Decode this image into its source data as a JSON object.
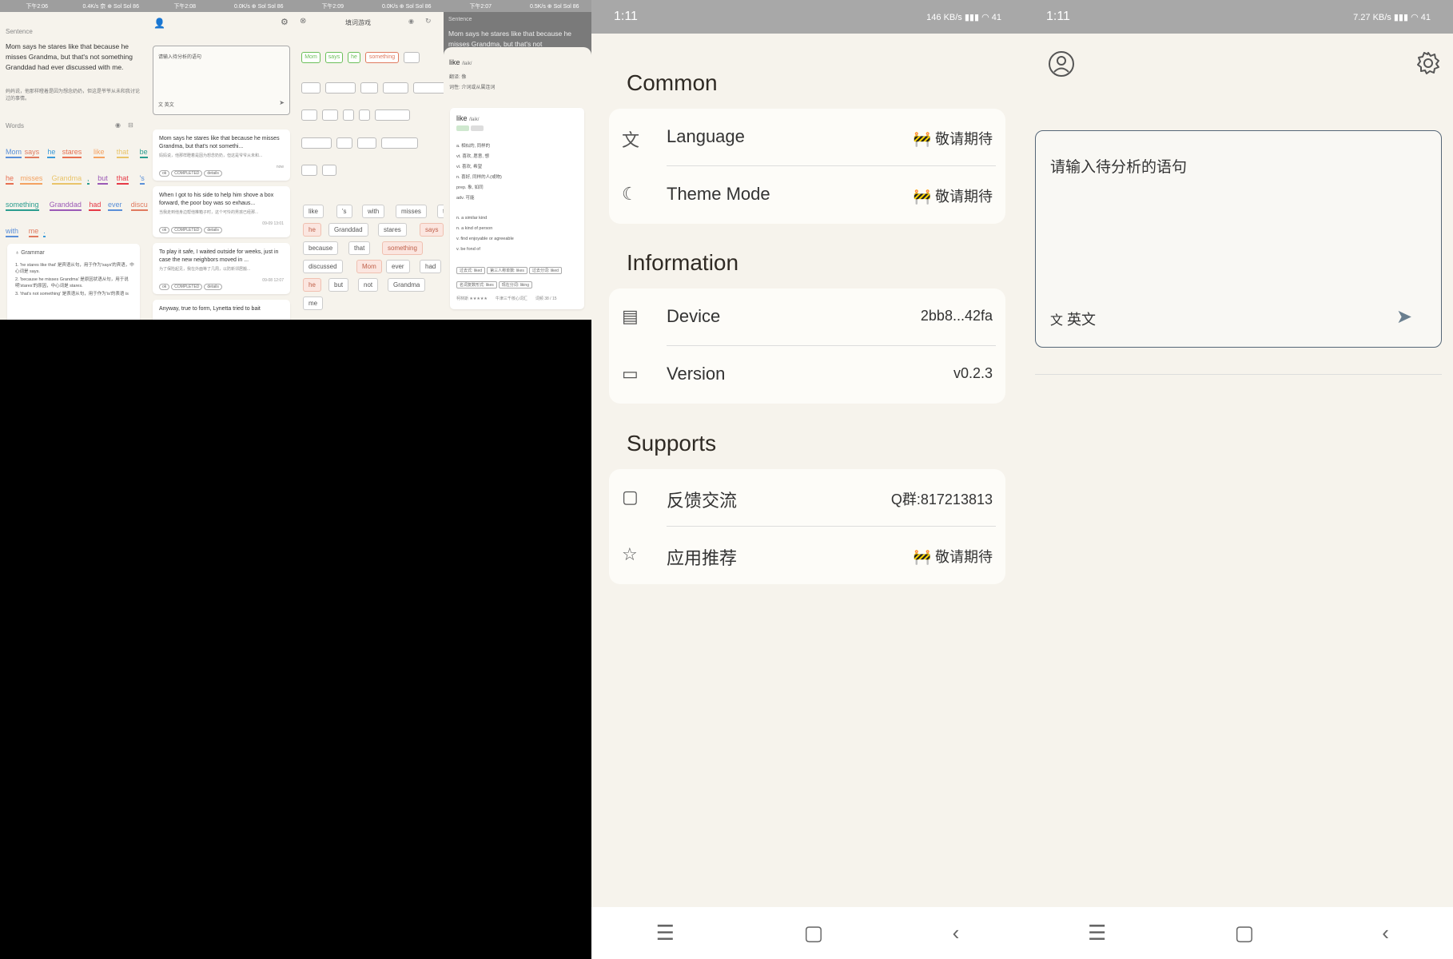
{
  "small": {
    "p1": {
      "status": [
        "下午2:06",
        "0.4K/s 奈 ⊕ Sol Sol 86"
      ],
      "sentence_label": "Sentence",
      "sentence": "Mom says he stares like that because he misses Grandma, but that's not something Granddad had ever discussed with me.",
      "translation": "妈妈说，他那样瞪着是因为想念奶奶，但这是爷爷从未和我讨论过的事情。",
      "words_label": "Words",
      "grammar_label": "Grammar",
      "grammar": [
        "1. 'he stares like that' 是宾语从句，用于作为'says'的宾语，中心词是 says.",
        "2. 'because he misses Grandma' 是原因状语从句，用于说明'stares'的原因，中心词是 stares.",
        "3. 'that's not something' 是表语从句，用于作为'is'的表语 is"
      ]
    },
    "p2": {
      "status": [
        "下午2:08",
        "0.0K/s ⊕ Sol Sol 86"
      ],
      "input_ph": "请输入待分析的语句",
      "lang": "英文",
      "cards": [
        {
          "text": "Mom says he stares like that because he misses Grandma, but that's not somethi...",
          "tr": "妈妈说，他那样瞪着是因为想念奶奶，但这是爷爷从未和...",
          "tags": [
            "ok",
            "COMPLETED",
            "details"
          ],
          "time": "now"
        },
        {
          "text": "When I got to his side to help him shove a box forward, the poor boy was so exhaus...",
          "tr": "当我走到他身边帮他推箱子时，这个可怜的男孩已经那...",
          "tags": [
            "ok",
            "COMPLETED",
            "details"
          ],
          "time": "09-09 13:01"
        },
        {
          "text": "To play it safe, I waited outside for weeks, just in case the new neighbors moved in ...",
          "tr": "为了保险起见，我在外面等了几周，以防新邻居搬...",
          "tags": [
            "ok",
            "COMPLETED",
            "details"
          ],
          "time": "09-08 12:07"
        },
        {
          "text": "Anyway, true to form, Lynetta tried to bait",
          "tr": "",
          "tags": [],
          "time": ""
        }
      ]
    },
    "p3": {
      "status": [
        "下午2:09",
        "0.0K/s ⊕ Sol Sol 86"
      ],
      "title": "填词游戏",
      "filled": [
        "Mom",
        "says",
        "he",
        "something"
      ],
      "chips": [
        "like",
        "'s",
        "with",
        "misses",
        "that",
        "he",
        "Granddad",
        "stares",
        "says",
        "because",
        "that",
        "something",
        "discussed",
        "Mom",
        "ever",
        "had",
        "he",
        "but",
        "not",
        "Grandma",
        "me"
      ]
    },
    "p4": {
      "status": [
        "下午2:07",
        "0.5K/s ⊕ Sol Sol 86"
      ],
      "sentence_label": "Sentence",
      "sentence": "Mom says he stares like that because he misses Grandma, but that's not",
      "word": "like",
      "phon": "/laik/",
      "trans_label": "翻译: 像",
      "pos_label": "词性: 介词或从属连词",
      "card_word": "like",
      "card_phon": "/laik/",
      "defs": [
        "a. 相似的, 同样的",
        "vt. 喜欢, 愿意, 想",
        "vi. 喜欢, 希望",
        "n. 喜好, 同样的人(或物)",
        "prep. 象, 如同",
        "adv. 可能"
      ],
      "endefs": [
        "n. a similar kind",
        "n. a kind of person",
        "v. find enjoyable or agreeable",
        "v. be fond of"
      ],
      "forms": [
        "过去式: liked",
        "第三人称单数: likes",
        "过去分词: liked",
        "名词复数形式: likes",
        "现在分词: liking"
      ],
      "footer": [
        "柯林斯 ★★★★★",
        "牛津三千核心词汇",
        "词频 38 / 15"
      ]
    }
  },
  "settings": {
    "time": "1:11",
    "net": "146 KB/s",
    "batt": "41",
    "sections": [
      {
        "title": "Common",
        "rows": [
          {
            "icon": "translate-icon",
            "label": "Language",
            "value": "🚧 敬请期待"
          },
          {
            "icon": "moon-icon",
            "label": "Theme Mode",
            "value": "🚧 敬请期待"
          }
        ]
      },
      {
        "title": "Information",
        "rows": [
          {
            "icon": "id-card-icon",
            "label": "Device",
            "value": "2bb8...42fa"
          },
          {
            "icon": "storage-icon",
            "label": "Version",
            "value": "v0.2.3"
          }
        ]
      },
      {
        "title": "Supports",
        "rows": [
          {
            "icon": "chat-icon",
            "label": "反馈交流",
            "value": "Q群:817213813"
          },
          {
            "icon": "star-icon",
            "label": "应用推荐",
            "value": "🚧 敬请期待"
          }
        ]
      }
    ]
  },
  "home": {
    "time": "1:11",
    "net": "7.27 KB/s",
    "batt": "41",
    "input_ph": "请输入待分析的语句",
    "lang": "英文"
  }
}
